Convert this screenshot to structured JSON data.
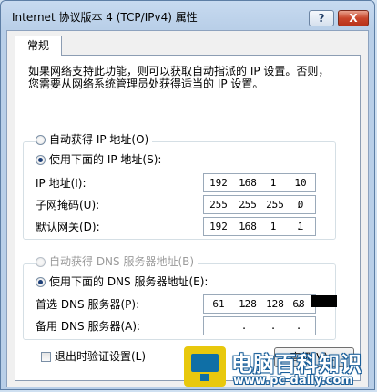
{
  "window": {
    "title": "Internet 协议版本 4 (TCP/IPv4) 属性",
    "help_label": "?",
    "close_label": "X"
  },
  "tabs": [
    {
      "label": "常规"
    }
  ],
  "description": {
    "line1": "如果网络支持此功能，则可以获取自动指派的 IP 设置。否则，",
    "line2": "您需要从网络系统管理员处获得适当的 IP 设置。"
  },
  "ip_section": {
    "auto_label": "自动获得 IP 地址(O)",
    "manual_label": "使用下面的 IP 地址(S):",
    "selected": "manual",
    "fields": [
      {
        "label": "IP 地址(I):",
        "octets": [
          "192",
          "168",
          "1",
          "10"
        ]
      },
      {
        "label": "子网掩码(U):",
        "octets": [
          "255",
          "255",
          "255",
          "0"
        ]
      },
      {
        "label": "默认网关(D):",
        "octets": [
          "192",
          "168",
          "1",
          "1"
        ]
      }
    ]
  },
  "dns_section": {
    "auto_label": "自动获得 DNS 服务器地址(B)",
    "manual_label": "使用下面的 DNS 服务器地址(E):",
    "selected": "manual",
    "fields": [
      {
        "label": "首选 DNS 服务器(P):",
        "octets": [
          "61",
          "128",
          "128",
          "68"
        ]
      },
      {
        "label": "备用 DNS 服务器(A):",
        "octets": [
          "",
          "",
          "",
          ""
        ]
      }
    ]
  },
  "validate_checkbox": {
    "label": "退出时验证设置(L)",
    "checked": false
  },
  "advanced_button": {
    "label": "高级(V)..."
  },
  "watermark": {
    "title": "电脑百科知识",
    "url": "www.pc-daily.com"
  },
  "colors": {
    "selected_radio": "#1d3f78",
    "close_button": "#c9462b",
    "watermark_yellow": "#e8c80d",
    "watermark_blue": "#1a5f9a"
  },
  "icons": {
    "help": "question-mark-icon",
    "close": "close-icon",
    "logo": "computer-monitor-icon"
  }
}
